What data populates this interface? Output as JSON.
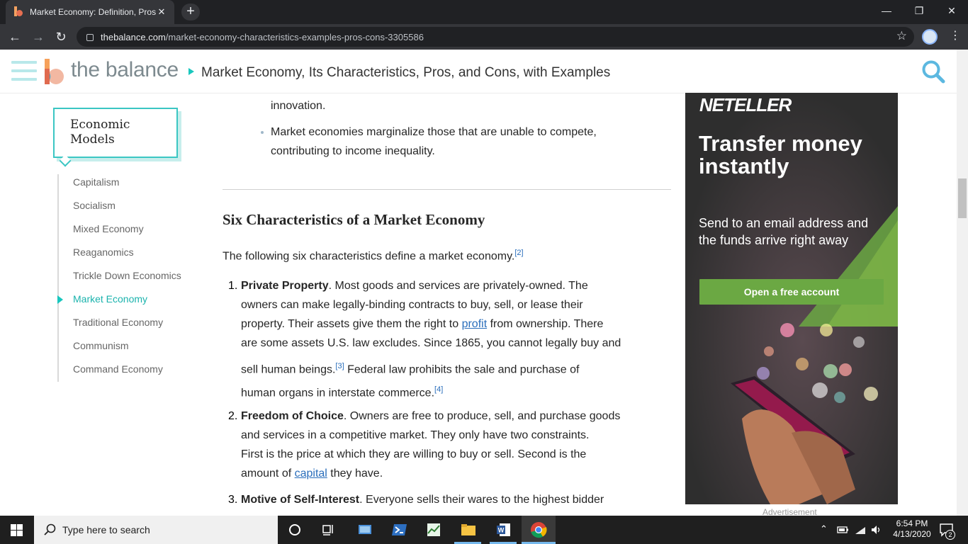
{
  "browser": {
    "tab_title": "Market Economy: Definition, Pros",
    "tab_close": "✕",
    "new_tab": "+",
    "url_host": "thebalance.com",
    "url_path": "/market-economy-characteristics-examples-pros-cons-3305586"
  },
  "site": {
    "logo_text": "the balance",
    "breadcrumb_title": "Market Economy, Its Characteristics, Pros, and Cons, with Examples"
  },
  "sidebar": {
    "title": "Economic Models",
    "items": [
      {
        "label": "Capitalism"
      },
      {
        "label": "Socialism"
      },
      {
        "label": "Mixed Economy"
      },
      {
        "label": "Reaganomics"
      },
      {
        "label": "Trickle Down Economics"
      },
      {
        "label": "Market Economy"
      },
      {
        "label": "Traditional Economy"
      },
      {
        "label": "Communism"
      },
      {
        "label": "Command Economy"
      }
    ],
    "active_index": 5
  },
  "article": {
    "bullet_cont": "innovation.",
    "bullet2_line1": "Market economies marginalize those that are unable to compete,",
    "bullet2_line2": "contributing to income inequality.",
    "heading": "Six Characteristics of a Market Economy",
    "intro": "The following six characteristics define a market economy.",
    "intro_ref": "[2]",
    "item1": {
      "num": "1.",
      "title": "Private Property",
      "l1": ". Most goods and services are privately-owned. The",
      "l2": "owners can make legally-binding contracts to buy, sell, or lease their",
      "l3a": "property. Their assets give them the right to ",
      "l3link": "profit",
      "l3b": " from ownership. There",
      "l4": "are some assets U.S. law excludes. Since 1865, you cannot legally buy and",
      "l5a": "sell human beings.",
      "ref3": "[3]",
      "l5b": " Federal law prohibits the sale and purchase of",
      "l6": "human organs in interstate commerce.",
      "ref4": "[4]"
    },
    "item2": {
      "num": "2.",
      "title": "Freedom of Choice",
      "l1": ". Owners are free to produce, sell, and purchase goods",
      "l2": "and services in a competitive market. They only have two constraints.",
      "l3": "First is the price at which they are willing to buy or sell. Second is the",
      "l4a": "amount of ",
      "l4link": "capital",
      "l4b": " they have."
    },
    "item3": {
      "num": "3.",
      "title": "Motive of Self-Interest",
      "l1": ". Everyone sells their wares to the highest bidder"
    }
  },
  "ad": {
    "brand": "NETELLER",
    "headline_1": "Transfer money",
    "headline_2": "instantly",
    "sub_1": "Send to an email address and",
    "sub_2": "the funds arrive right away",
    "cta": "Open a free account",
    "label": "Advertisement"
  },
  "taskbar": {
    "search_placeholder": "Type here to search",
    "time": "6:54 PM",
    "date": "4/13/2020",
    "notifications": "2"
  },
  "colors": {
    "accent": "#19c7be",
    "link": "#2a6ebb",
    "ad_green": "#6ba843"
  }
}
